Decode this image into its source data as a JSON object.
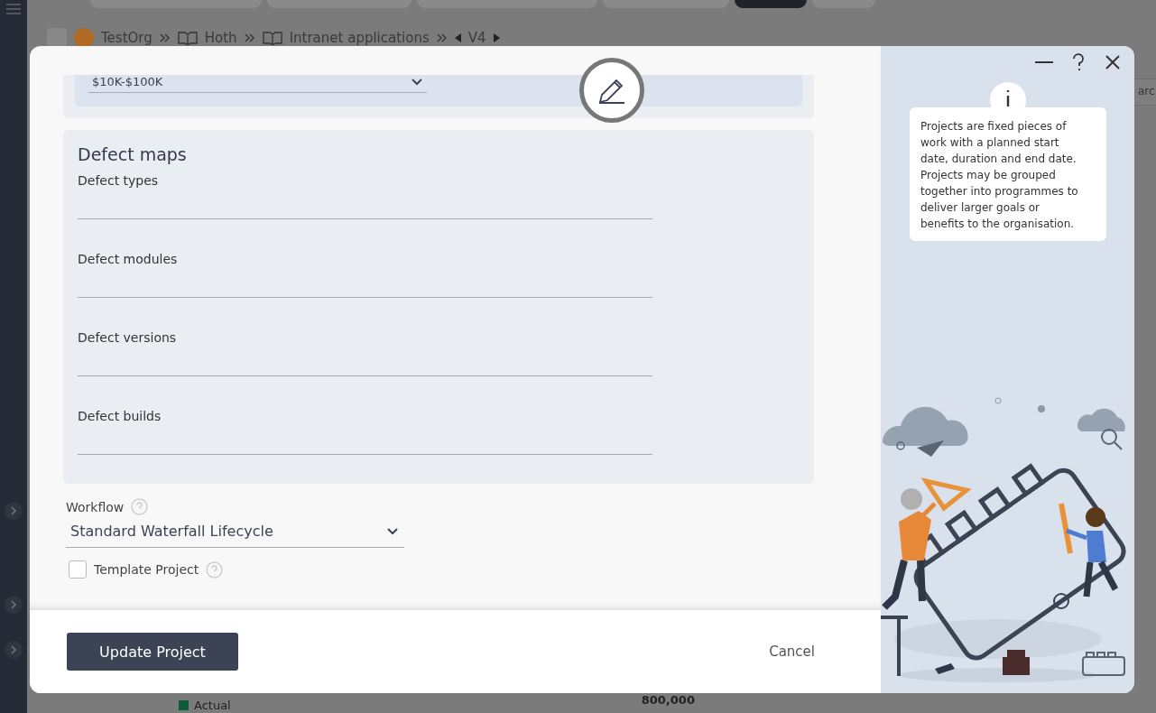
{
  "background": {
    "tabs": [
      {
        "selected": false
      },
      {
        "selected": false
      },
      {
        "selected": false
      },
      {
        "selected": false
      },
      {
        "selected": true
      },
      {
        "selected": false
      }
    ],
    "breadcrumb": [
      {
        "label": "TestOrg",
        "kind": "org"
      },
      {
        "label": "Hoth",
        "kind": "book"
      },
      {
        "label": "Intranet applications",
        "kind": "book"
      }
    ],
    "version": "V4",
    "search_partial": "arc",
    "axis_value": "800,000",
    "legend": "Actual"
  },
  "modal": {
    "budget": {
      "value": "$10K-$100K"
    },
    "defect_maps": {
      "title": "Defect maps",
      "fields": [
        {
          "label": "Defect types"
        },
        {
          "label": "Defect modules"
        },
        {
          "label": "Defect versions"
        },
        {
          "label": "Defect builds"
        }
      ]
    },
    "workflow": {
      "label": "Workflow",
      "value": "Standard Waterfall Lifecycle"
    },
    "template_project": {
      "label": "Template Project",
      "checked": false
    },
    "primary_button": "Update Project",
    "cancel": "Cancel",
    "info_text": "Projects are fixed pieces of work with a planned start date, duration and end date. Projects may be grouped together into programmes to deliver larger goals or benefits to the organisation."
  }
}
